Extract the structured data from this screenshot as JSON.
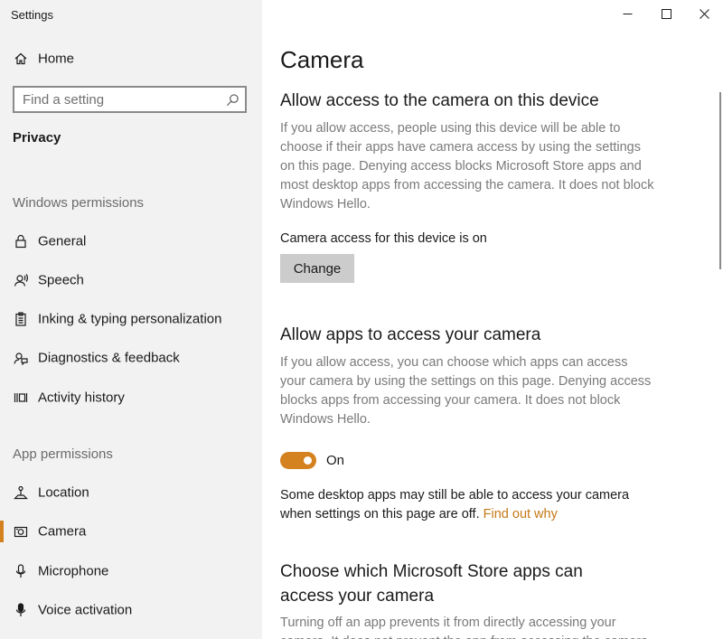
{
  "window": {
    "app_title": "Settings",
    "controls": {
      "minimize": "minimize",
      "maximize": "maximize",
      "close": "close"
    }
  },
  "sidebar": {
    "home_label": "Home",
    "search": {
      "value": "",
      "placeholder": "Find a setting"
    },
    "category": "Privacy",
    "windows_permissions": {
      "title": "Windows permissions",
      "items": [
        {
          "label": "General",
          "icon": "lock-icon"
        },
        {
          "label": "Speech",
          "icon": "speech-icon"
        },
        {
          "label": "Inking & typing personalization",
          "icon": "clipboard-icon"
        },
        {
          "label": "Diagnostics & feedback",
          "icon": "feedback-icon"
        },
        {
          "label": "Activity history",
          "icon": "activity-history-icon"
        }
      ]
    },
    "app_permissions": {
      "title": "App permissions",
      "items": [
        {
          "label": "Location",
          "icon": "location-icon",
          "selected": false
        },
        {
          "label": "Camera",
          "icon": "camera-icon",
          "selected": true
        },
        {
          "label": "Microphone",
          "icon": "microphone-icon",
          "selected": false
        },
        {
          "label": "Voice activation",
          "icon": "voice-activation-icon",
          "selected": false
        }
      ]
    }
  },
  "main": {
    "title": "Camera",
    "device_section": {
      "heading": "Allow access to the camera on this device",
      "description": "If you allow access, people using this device will be able to choose if their apps have camera access by using the settings on this page. Denying access blocks Microsoft Store apps and most desktop apps from accessing the camera. It does not block Windows Hello.",
      "status": "Camera access for this device is on",
      "change_button": "Change"
    },
    "apps_section": {
      "heading": "Allow apps to access your camera",
      "description": "If you allow access, you can choose which apps can access your camera by using the settings on this page. Denying access blocks apps from accessing your camera. It does not block Windows Hello.",
      "toggle_state": "On",
      "toggle_on": true,
      "note": "Some desktop apps may still be able to access your camera when settings on this page are off.",
      "link": "Find out why"
    },
    "store_section": {
      "heading": "Choose which Microsoft Store apps can access your camera",
      "description": "Turning off an app prevents it from directly accessing your camera. It does not prevent the app from accessing the camera indirectly through the Windows' Camera app."
    }
  },
  "colors": {
    "accent": "#d4821f",
    "link": "#c47814",
    "sidebar_bg": "#f2f2f2",
    "secondary_text": "#7a7a7a"
  }
}
